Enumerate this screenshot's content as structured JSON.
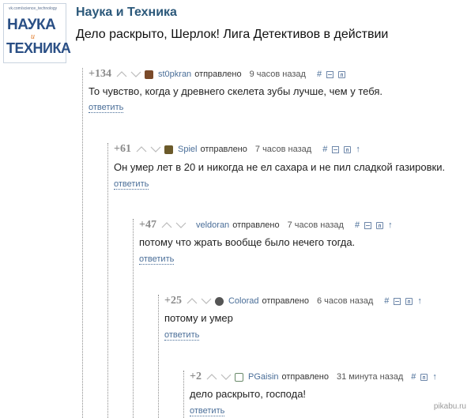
{
  "group": {
    "name": "Наука и Техника",
    "logo": {
      "url": "vk.com/science_technology",
      "word1": "НАУКА",
      "word2": "и",
      "word3": "ТЕХНИКА"
    }
  },
  "post": {
    "title": "Дело раскрыто, Шерлок! Лига Детективов в действии"
  },
  "labels": {
    "sent": "отправлено",
    "reply": "ответить"
  },
  "colors": {
    "link": "#4a6e98",
    "title": "#2b587a",
    "score": "#8a8a8a"
  },
  "comments": [
    {
      "score": "+134",
      "user": "st0pkran",
      "time": "9 часов назад",
      "avatar_color": "#7a4a2a",
      "text": "То чувство, когда у древнего скелета зубы лучше, чем у тебя.",
      "has_up": false
    },
    {
      "score": "+61",
      "user": "Spiel",
      "time": "7 часов назад",
      "avatar_color": "#6b5a2a",
      "text": "Он умер лет в 20 и никогда не ел сахара и не пил сладкой газировки.",
      "has_up": true
    },
    {
      "score": "+47",
      "user": "veldoran",
      "time": "7 часов назад",
      "avatar_color": "",
      "text": "потому что жрать вообще было нечего тогда.",
      "has_up": true
    },
    {
      "score": "+25",
      "user": "Colorad",
      "time": "6 часов назад",
      "avatar_color": "#555555",
      "text": "потому и умер",
      "has_up": true
    },
    {
      "score": "+2",
      "user": "PGaisin",
      "time": "31 минута назад",
      "avatar_color": "#6a8a6a",
      "text": "дело раскрыто, господа!",
      "has_up": true
    }
  ],
  "watermark": "pikabu.ru"
}
